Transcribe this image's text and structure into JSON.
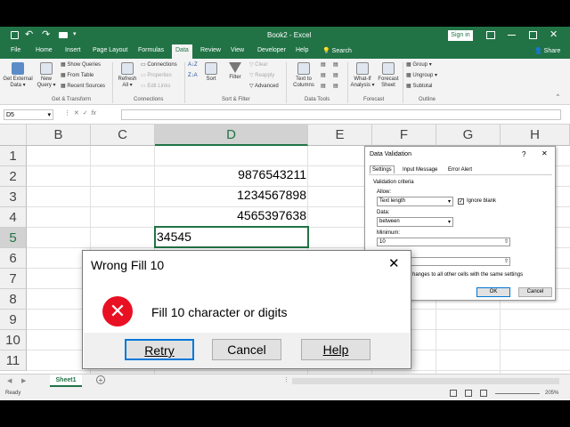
{
  "title": {
    "book": "Book2",
    "app": "Excel",
    "signin": "Sign in"
  },
  "ribbon": {
    "tabs": [
      "File",
      "Home",
      "Insert",
      "Page Layout",
      "Formulas",
      "Data",
      "Review",
      "View",
      "Developer",
      "Help"
    ],
    "tellme": "Search",
    "share": "Share",
    "buttons": {
      "get_external": [
        "Get External",
        "Data"
      ],
      "new_query": [
        "New",
        "Query"
      ],
      "show_queries": "Show Queries",
      "from_table": "From Table",
      "recent_sources": "Recent Sources",
      "refresh_all": [
        "Refresh",
        "All"
      ],
      "connections": "Connections",
      "properties": "Properties",
      "edit_links": "Edit Links",
      "sort": "Sort",
      "filter": "Filter",
      "clear": "Clear",
      "reapply": "Reapply",
      "advanced": "Advanced",
      "text_to_columns": [
        "Text to",
        "Columns"
      ],
      "what_if": [
        "What-If",
        "Analysis"
      ],
      "forecast_sheet": [
        "Forecast",
        "Sheet"
      ],
      "group": "Group",
      "ungroup": "Ungroup",
      "subtotal": "Subtotal"
    },
    "groups": [
      "Get & Transform",
      "Connections",
      "Sort & Filter",
      "Data Tools",
      "Forecast",
      "Outline"
    ]
  },
  "name_box": "D5",
  "fx": "fx",
  "columns": [
    "B",
    "C",
    "D",
    "E",
    "F",
    "G",
    "H"
  ],
  "rows": [
    "1",
    "2",
    "3",
    "4",
    "5",
    "6",
    "7",
    "8",
    "9",
    "10",
    "11"
  ],
  "cells": {
    "d2": "9876543211",
    "d3": "1234567898",
    "d4": "4565397638",
    "d5": "34545"
  },
  "data_validation": {
    "title": "Data Validation",
    "help": "?",
    "tabs": [
      "Settings",
      "Input Message",
      "Error Alert"
    ],
    "criteria": "Validation criteria",
    "allow_label": "Allow:",
    "allow_value": "Text length",
    "ignore_blank": "Ignore blank",
    "data_label": "Data:",
    "data_value": "between",
    "minimum_label": "Minimum:",
    "minimum_value": "10",
    "apply_text": "hanges to all other cells with the same settings",
    "ok": "OK",
    "cancel": "Cancel"
  },
  "message": {
    "title": "Wrong Fill 10",
    "text": "Fill 10 character or digits",
    "retry": "Retry",
    "cancel": "Cancel",
    "help": "Help",
    "close": "✕"
  },
  "sheet_tab": "Sheet1",
  "status": {
    "ready": "Ready",
    "zoom": "205%"
  },
  "colors": {
    "excel_green": "#217346",
    "error_red": "#e81123"
  }
}
